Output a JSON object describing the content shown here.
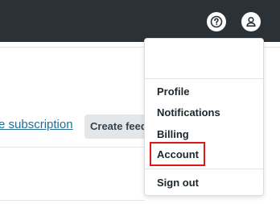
{
  "topbar": {
    "bg_color": "#2a3237",
    "help_icon": "question-circle-icon",
    "user_icon": "user-avatar-icon"
  },
  "content": {
    "subscription_link": "e subscription",
    "create_button": "Create feed"
  },
  "menu": {
    "items": [
      {
        "label": "Profile"
      },
      {
        "label": "Notifications"
      },
      {
        "label": "Billing"
      },
      {
        "label": "Account",
        "highlighted": true
      },
      {
        "label": "Sign out"
      }
    ]
  },
  "highlight_color": "#e01818",
  "link_color": "#1f6f99"
}
